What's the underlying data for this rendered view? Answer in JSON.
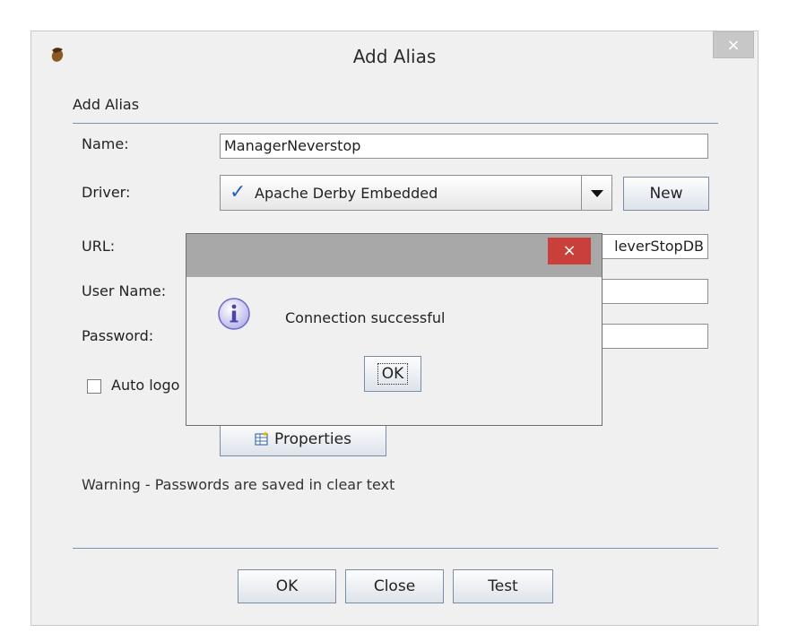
{
  "window": {
    "title": "Add Alias",
    "close_glyph": "×",
    "app_icon": "acorn-icon"
  },
  "panel": {
    "title": "Add Alias"
  },
  "form": {
    "name_label": "Name:",
    "name_value": "ManagerNeverstop",
    "driver_label": "Driver:",
    "driver_value": "Apache Derby Embedded",
    "driver_check_glyph": "✓",
    "new_button": "New",
    "url_label": "URL:",
    "url_value_visible": "leverStopDB",
    "username_label": "User Name:",
    "username_value": "",
    "password_label": "Password:",
    "password_value": "",
    "auto_logon_label": "Auto logo",
    "auto_logon_checked": false,
    "properties_button": "Properties",
    "properties_icon": "table-properties-icon",
    "warning_text": "Warning - Passwords are saved in clear text"
  },
  "footer": {
    "ok": "OK",
    "close": "Close",
    "test": "Test"
  },
  "modal": {
    "message": "Connection successful",
    "ok": "OK",
    "close_glyph": "×",
    "icon": "info-icon",
    "accent_close": "#c9403a"
  },
  "colors": {
    "panel_line": "#7e8fb8",
    "check_blue": "#2a5fc4"
  }
}
